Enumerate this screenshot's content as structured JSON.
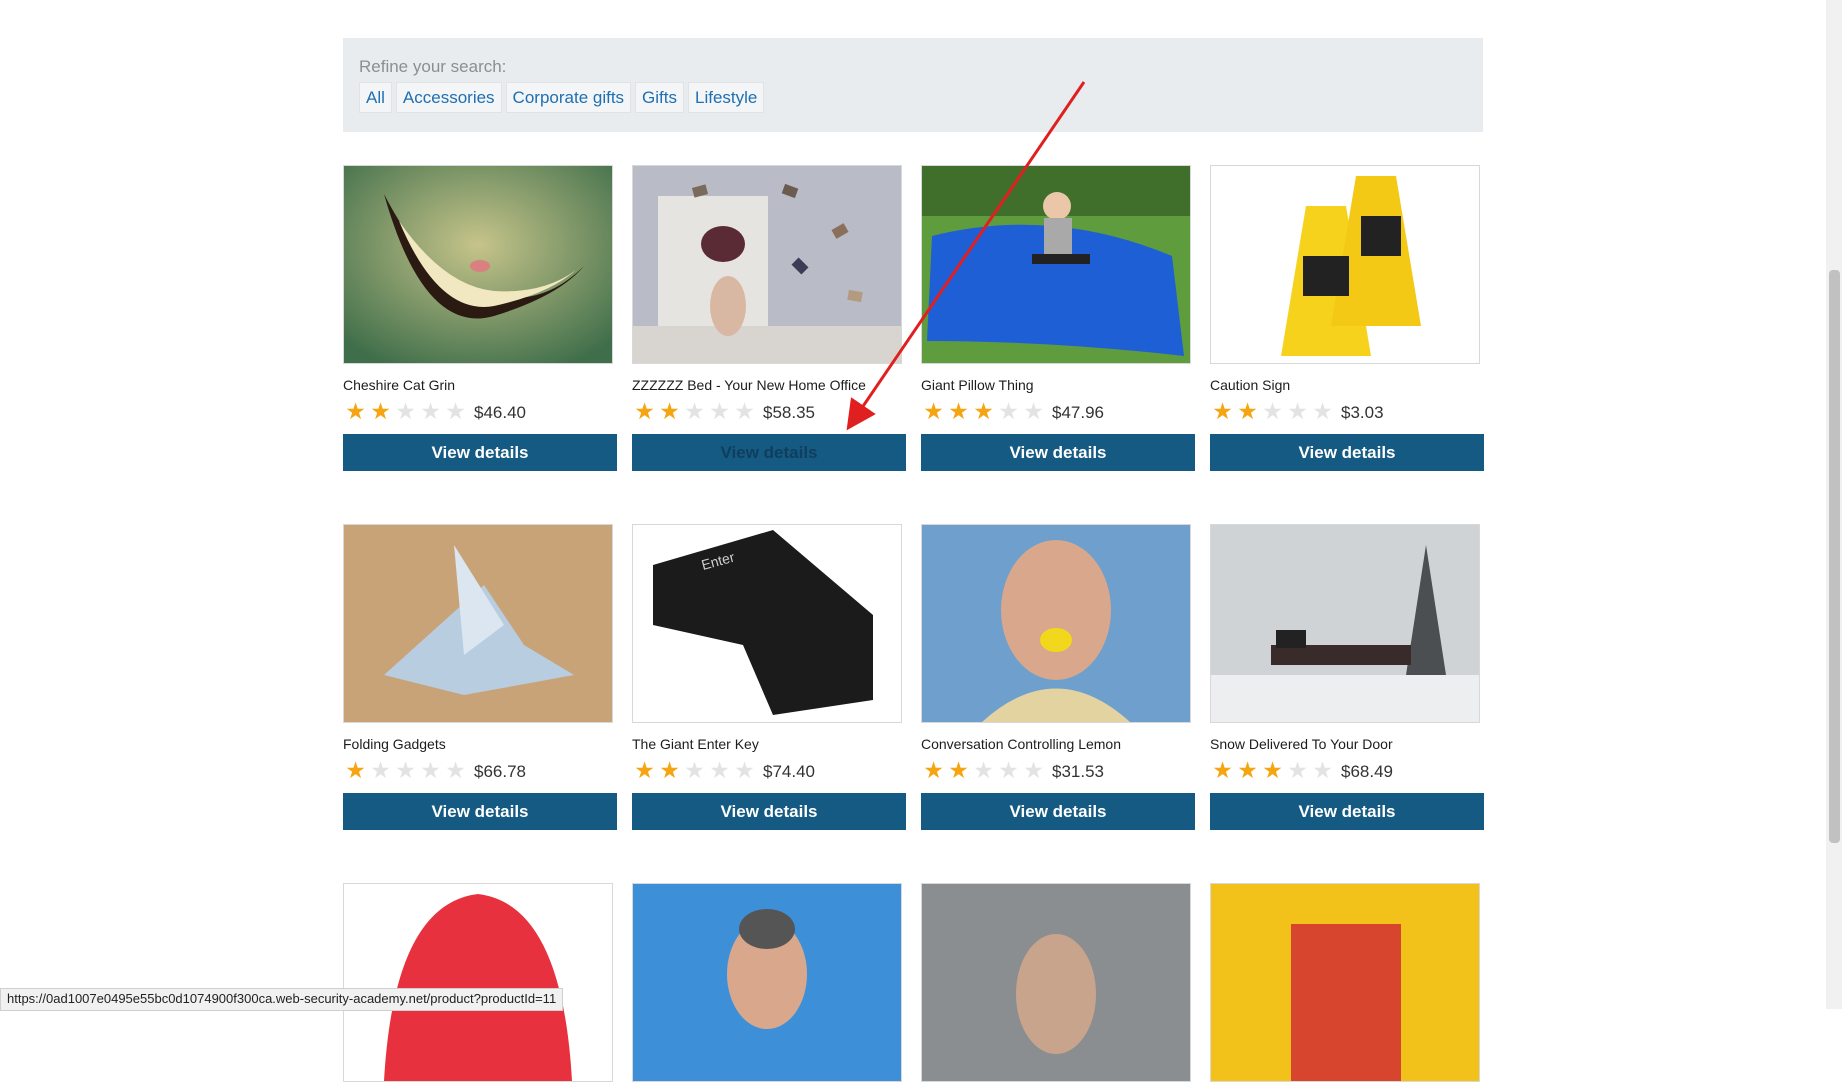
{
  "refine": {
    "label": "Refine your search:",
    "filters": [
      "All",
      "Accessories",
      "Corporate gifts",
      "Gifts",
      "Lifestyle"
    ]
  },
  "products": [
    {
      "name": "Cheshire Cat Grin",
      "price": "$46.40",
      "rating": 2,
      "button": "View details"
    },
    {
      "name": "ZZZZZZ Bed - Your New Home Office",
      "price": "$58.35",
      "rating": 2,
      "button": "View details"
    },
    {
      "name": "Giant Pillow Thing",
      "price": "$47.96",
      "rating": 3,
      "button": "View details"
    },
    {
      "name": "Caution Sign",
      "price": "$3.03",
      "rating": 2,
      "button": "View details"
    },
    {
      "name": "Folding Gadgets",
      "price": "$66.78",
      "rating": 1,
      "button": "View details"
    },
    {
      "name": "The Giant Enter Key",
      "price": "$74.40",
      "rating": 2,
      "button": "View details"
    },
    {
      "name": "Conversation Controlling Lemon",
      "price": "$31.53",
      "rating": 2,
      "button": "View details"
    },
    {
      "name": "Snow Delivered To Your Door",
      "price": "$68.49",
      "rating": 3,
      "button": "View details"
    }
  ],
  "status_url": "https://0ad1007e0495e55bc0d1074900f300ca.web-security-academy.net/product?productId=11",
  "colors": {
    "button": "#145a83",
    "star": "#f5a511",
    "link": "#1f6fb2",
    "arrow": "#e02020"
  },
  "image_text": {
    "enter_key": "Enter"
  }
}
